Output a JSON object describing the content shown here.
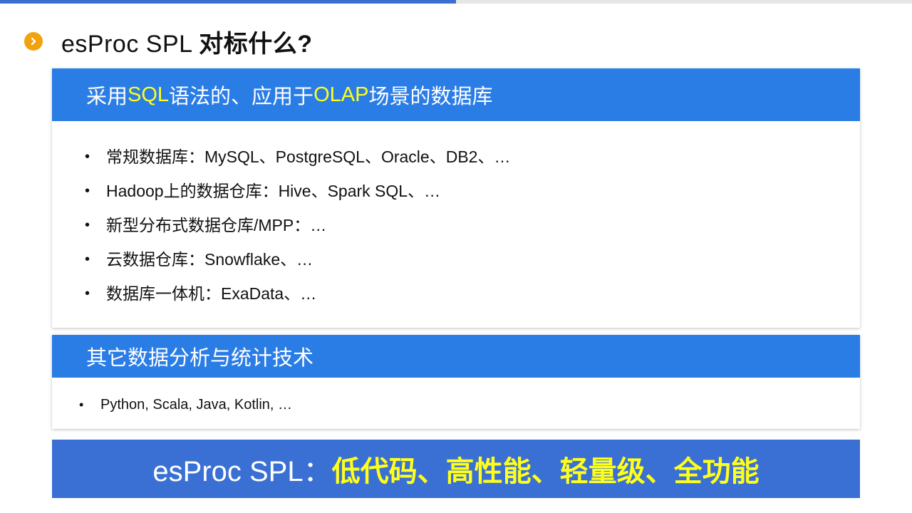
{
  "slide": {
    "title_latin": "esProc SPL ",
    "title_cjk": "对标什么?",
    "accent_color": "#f2a20c",
    "header_color": "#2b7de6",
    "highlight_color": "#ffff1a"
  },
  "card1": {
    "header_parts": [
      "采用",
      "SQL",
      "语法的、应用于",
      "OLAP",
      "场景的数据库"
    ],
    "items": [
      "常规数据库：MySQL、PostgreSQL、Oracle、DB2、…",
      "Hadoop上的数据仓库：Hive、Spark SQL、…",
      "新型分布式数据仓库/MPP：…",
      "云数据仓库：Snowflake、…",
      "数据库一体机：ExaData、…"
    ]
  },
  "card2": {
    "header": "其它数据分析与统计技术",
    "items": [
      "Python, Scala, Java, Kotlin, …"
    ]
  },
  "banner": {
    "lead": "esProc SPL：",
    "highlight": "低代码、高性能、轻量级、全功能"
  }
}
